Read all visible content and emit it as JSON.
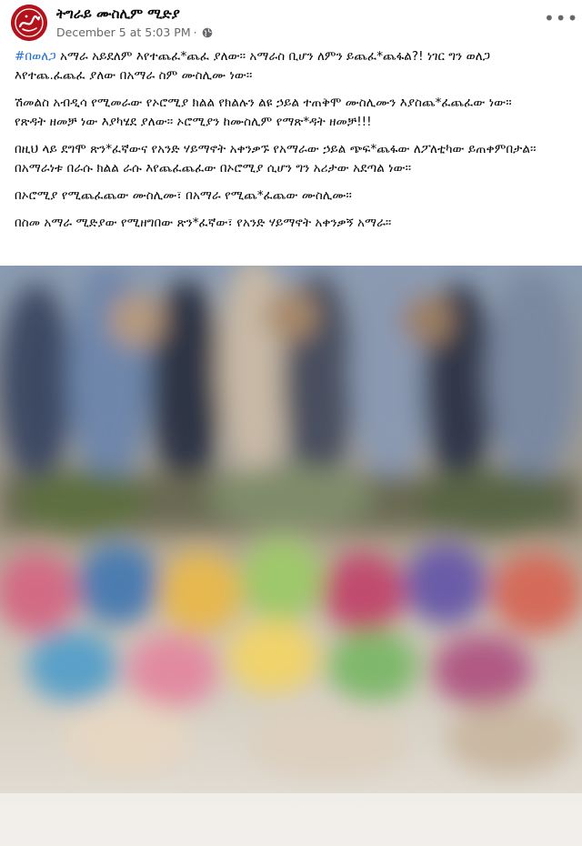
{
  "post": {
    "page_name": "ትግራይ ሙስሊም ሚድያ",
    "date": "December 5 at 5:03 PM",
    "separator": "·",
    "privacy_icon": "globe-icon",
    "more_icon": "more-options-icon",
    "more_label": "•••",
    "avatar_icon": "calligraphy-logo",
    "paragraphs": [
      {
        "hashtag": "#በወለጋ",
        "text": " አማራ አይደለም እየተጨፈ*ጨፈ ያለው፡፡ አማራስ ቢሆን ለምን ይጨፈ*ጨፋል?! ነገር ግን ወለጋ እየተጨ.ፈጨፈ ያለው በአማራ ስም ሙስሊሙ ነው፡፡"
      },
      {
        "hashtag": "",
        "text": "ሽመልስ አብዲሳ የሚመራው የኦሮሚያ ክልል የክልሉን ልዩ ኃይል ተጠቅሞ ሙስሊሙን እያስጨ*ፈጨፈው ነው፡፡ የጽዳት ዘመቻ ነው እያካሄደ ያለው፡፡ ኦሮሚያን ከሙስሊም የማጽ*ዳት ዘመቻ!!!"
      },
      {
        "hashtag": "",
        "text": "በዚህ ላይ ደግሞ ጽን*ፈኛውና የአንድ ሃይማኖት አቀንቃኙ የአማራው ኃይል ጭፍ*ጨፋው ለፖለቲካው ይጠቀምበታል፡፡ በአማራነቱ በራሱ ክልል ራሱ እየጨፈጨፈው በኦሮሚያ ሲሆን ግን አሪታው አደጣል ነው፡፡"
      },
      {
        "hashtag": "",
        "text": "በኦሮሚያ የሚጨፈጨው ሙስሊሙ፣ በአማራ የሚጨ*ፈጨው ሙስሊሙ፡፡"
      },
      {
        "hashtag": "",
        "text": "በስመ አማራ ሚድያው የሚዘግበው ጽን*ፈኛው፣ የአንድ ሃይማኖት አቀንቃኝ አማራ፡፡"
      }
    ],
    "photo": {
      "content": "blurred-group-photo",
      "colors": [
        "#9bb0c9",
        "#3e4a63",
        "#c8b9a6",
        "#7f8c6b",
        "#d36a84",
        "#4c7cb0",
        "#e6d7c2",
        "#5d6e3f"
      ]
    }
  }
}
